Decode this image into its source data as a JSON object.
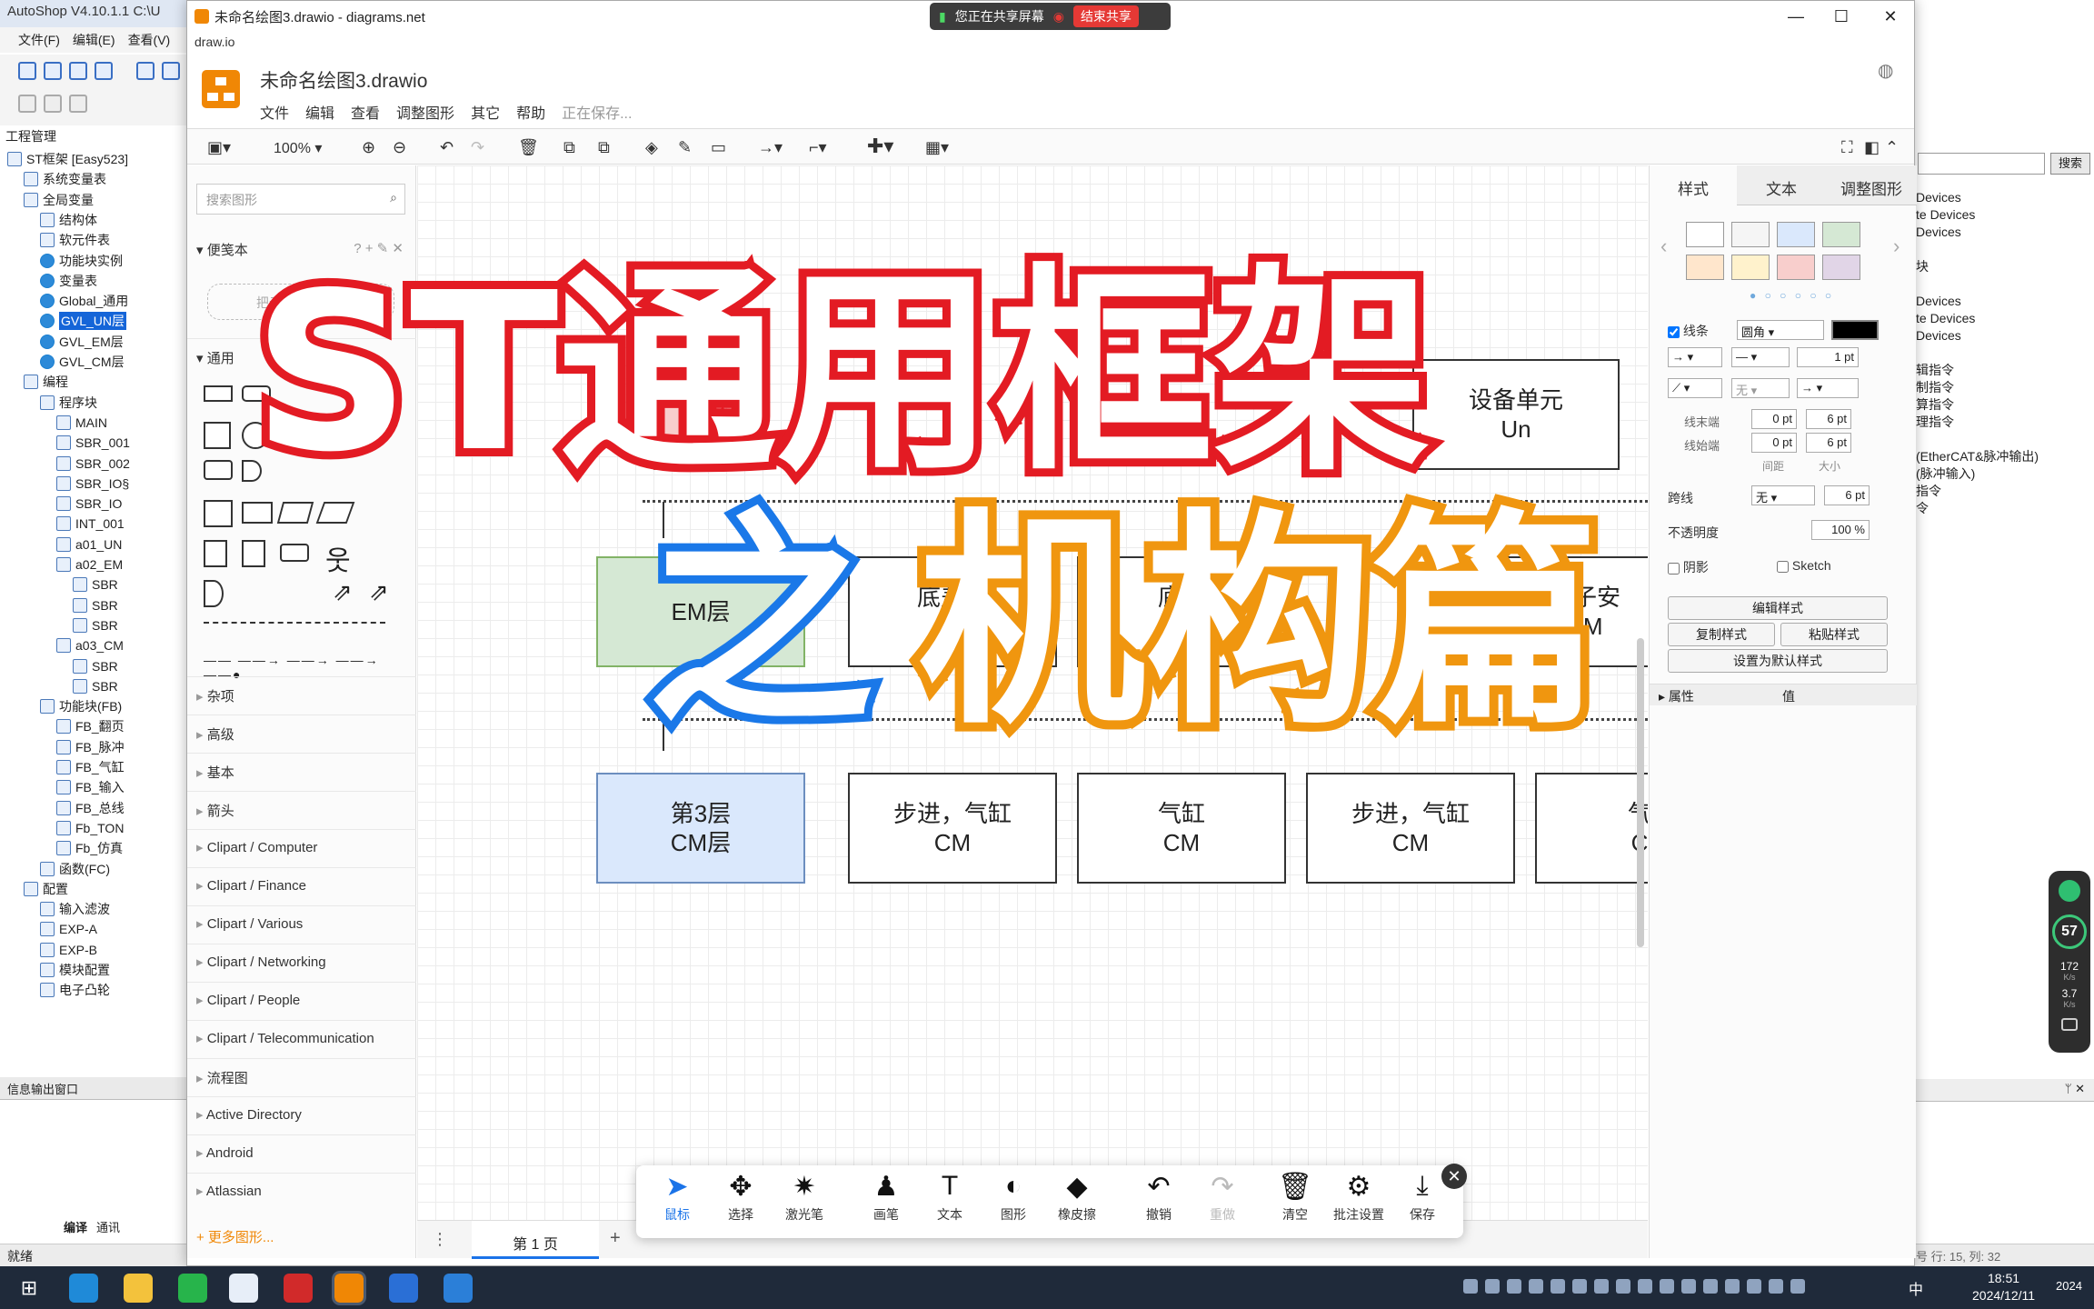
{
  "autoshop": {
    "title": "AutoShop V4.10.1.1  C:\\U",
    "menu": [
      "文件(F)",
      "编辑(E)",
      "查看(V)"
    ],
    "project_header": "工程管理",
    "tree": [
      {
        "label": "ST框架 [Easy523]",
        "indent": 0
      },
      {
        "label": "系统变量表",
        "indent": 1
      },
      {
        "label": "全局变量",
        "indent": 1
      },
      {
        "label": "结构体",
        "indent": 2
      },
      {
        "label": "软元件表",
        "indent": 2
      },
      {
        "label": "功能块实例",
        "indent": 2
      },
      {
        "label": "变量表",
        "indent": 2
      },
      {
        "label": "Global_通用",
        "indent": 2
      },
      {
        "label": "GVL_UN层",
        "indent": 2,
        "selected": true
      },
      {
        "label": "GVL_EM层",
        "indent": 2
      },
      {
        "label": "GVL_CM层",
        "indent": 2
      },
      {
        "label": "编程",
        "indent": 1
      },
      {
        "label": "程序块",
        "indent": 2
      },
      {
        "label": "MAIN",
        "indent": 3
      },
      {
        "label": "SBR_001",
        "indent": 3
      },
      {
        "label": "SBR_002",
        "indent": 3
      },
      {
        "label": "SBR_IO§",
        "indent": 3
      },
      {
        "label": "SBR_IO",
        "indent": 3
      },
      {
        "label": "INT_001",
        "indent": 3
      },
      {
        "label": "a01_UN",
        "indent": 3
      },
      {
        "label": "a02_EM",
        "indent": 3
      },
      {
        "label": "SBR",
        "indent": 4
      },
      {
        "label": "SBR",
        "indent": 4
      },
      {
        "label": "SBR",
        "indent": 4
      },
      {
        "label": "a03_CM",
        "indent": 3
      },
      {
        "label": "SBR",
        "indent": 4
      },
      {
        "label": "SBR",
        "indent": 4
      },
      {
        "label": "功能块(FB)",
        "indent": 2
      },
      {
        "label": "FB_翻页",
        "indent": 3
      },
      {
        "label": "FB_脉冲",
        "indent": 3
      },
      {
        "label": "FB_气缸",
        "indent": 3
      },
      {
        "label": "FB_输入",
        "indent": 3
      },
      {
        "label": "FB_总线",
        "indent": 3
      },
      {
        "label": "Fb_TON",
        "indent": 3
      },
      {
        "label": "Fb_仿真",
        "indent": 3
      },
      {
        "label": "函数(FC)",
        "indent": 2
      },
      {
        "label": "配置",
        "indent": 1
      },
      {
        "label": "输入滤波",
        "indent": 2
      },
      {
        "label": "EXP-A",
        "indent": 2
      },
      {
        "label": "EXP-B",
        "indent": 2
      },
      {
        "label": "模块配置",
        "indent": 2
      },
      {
        "label": "电子凸轮",
        "indent": 2
      }
    ],
    "output_window": "信息输出窗口",
    "bottom_tabs": [
      "编译",
      "通讯"
    ],
    "status": "就绪",
    "right_panel_lines": "Devices\nte Devices\nDevices\n\n块\n\nDevices\nte Devices\nDevices\n\n辑指令\n制指令\n算指令\n理指令\n\n(EtherCAT&脉冲输出)\n(脉冲输入)\n指令\n令",
    "right_search_button": "搜索",
    "right_status": "号 行: 15, 列: 32"
  },
  "drawio": {
    "window_title": "未命名绘图3.drawio - diagrams.net",
    "app_name": "draw.io",
    "share_text": "您正在共享屏幕",
    "stop_share": "结束共享",
    "filename": "未命名绘图3.drawio",
    "menu": [
      "文件",
      "编辑",
      "查看",
      "调整图形",
      "其它",
      "帮助"
    ],
    "saving": "正在保存...",
    "zoom": "100%",
    "search_placeholder": "搜索图形",
    "scratchpad": "便笺本",
    "scratch_drop": "把元素拖至此处",
    "general": "通用",
    "sections": [
      "杂项",
      "高级",
      "基本",
      "箭头",
      "Clipart / Computer",
      "Clipart / Finance",
      "Clipart / Various",
      "Clipart / Networking",
      "Clipart / People",
      "Clipart / Telecommunication",
      "流程图",
      "Active Directory",
      "Android",
      "Atlassian"
    ],
    "more_shapes": "+ 更多图形...",
    "page_tab": "第 1 页",
    "nodes": {
      "un_device": "设备单元\nUn",
      "em_layer": "EM层",
      "em1": "底盖上\nEM",
      "em2": "底盖\nE",
      "em3": "转子安\nEM",
      "cm_layer": "第3层\nCM层",
      "cm1": "步进，气缸\nCM",
      "cm2": "气缸\nCM",
      "cm3": "步进，气缸\nCM",
      "cm4": "气\nC"
    },
    "format": {
      "tabs": [
        "样式",
        "文本",
        "调整图形"
      ],
      "swatches": [
        "#ffffff",
        "#f5f5f5",
        "#dae8fc",
        "#d5e8d4",
        "#ffe6cc",
        "#fff2cc",
        "#f8cecc",
        "#e1d5e7"
      ],
      "line_label": "线条",
      "line_style": "圆角",
      "line_width": "1 pt",
      "line_end_label": "线末端",
      "line_start_label": "线始端",
      "line_end_val": "0 pt",
      "line_end_size": "6 pt",
      "line_start_val": "0 pt",
      "line_start_size": "6 pt",
      "spacing": "间距",
      "size": "大小",
      "jump_label": "跨线",
      "jump_style": "无",
      "jump_size": "6 pt",
      "opacity_label": "不透明度",
      "opacity": "100 %",
      "shadow": "阴影",
      "sketch": "Sketch",
      "edit_style": "编辑样式",
      "copy_style": "复制样式",
      "paste_style": "粘贴样式",
      "set_default": "设置为默认样式",
      "prop": "属性",
      "value": "值",
      "none_arrow": "无"
    },
    "tools": [
      {
        "glyph": "➤",
        "label": "鼠标",
        "state": "active"
      },
      {
        "glyph": "✥",
        "label": "选择",
        "state": ""
      },
      {
        "glyph": "✷",
        "label": "激光笔",
        "state": ""
      },
      {
        "glyph": "♟",
        "label": "画笔",
        "state": ""
      },
      {
        "glyph": "T",
        "label": "文本",
        "state": ""
      },
      {
        "glyph": "◐",
        "label": "图形",
        "state": ""
      },
      {
        "glyph": "◆",
        "label": "橡皮擦",
        "state": ""
      },
      {
        "glyph": "↶",
        "label": "撤销",
        "state": ""
      },
      {
        "glyph": "↷",
        "label": "重做",
        "state": "disabled"
      },
      {
        "glyph": "🗑",
        "label": "清空",
        "state": ""
      },
      {
        "glyph": "⚙",
        "label": "批注设置",
        "state": ""
      },
      {
        "glyph": "⤓",
        "label": "保存",
        "state": ""
      }
    ]
  },
  "overlay": {
    "line1": "ST通用框架",
    "line2_a": "之",
    "line2_b": "机构篇"
  },
  "meter": {
    "percent": "57",
    "up": "172",
    "down": "3.7",
    "unit": "K/s"
  },
  "taskbar": {
    "time": "18:51",
    "date": "2024/12/11",
    "ime": "中",
    "year_tail": "2024"
  }
}
